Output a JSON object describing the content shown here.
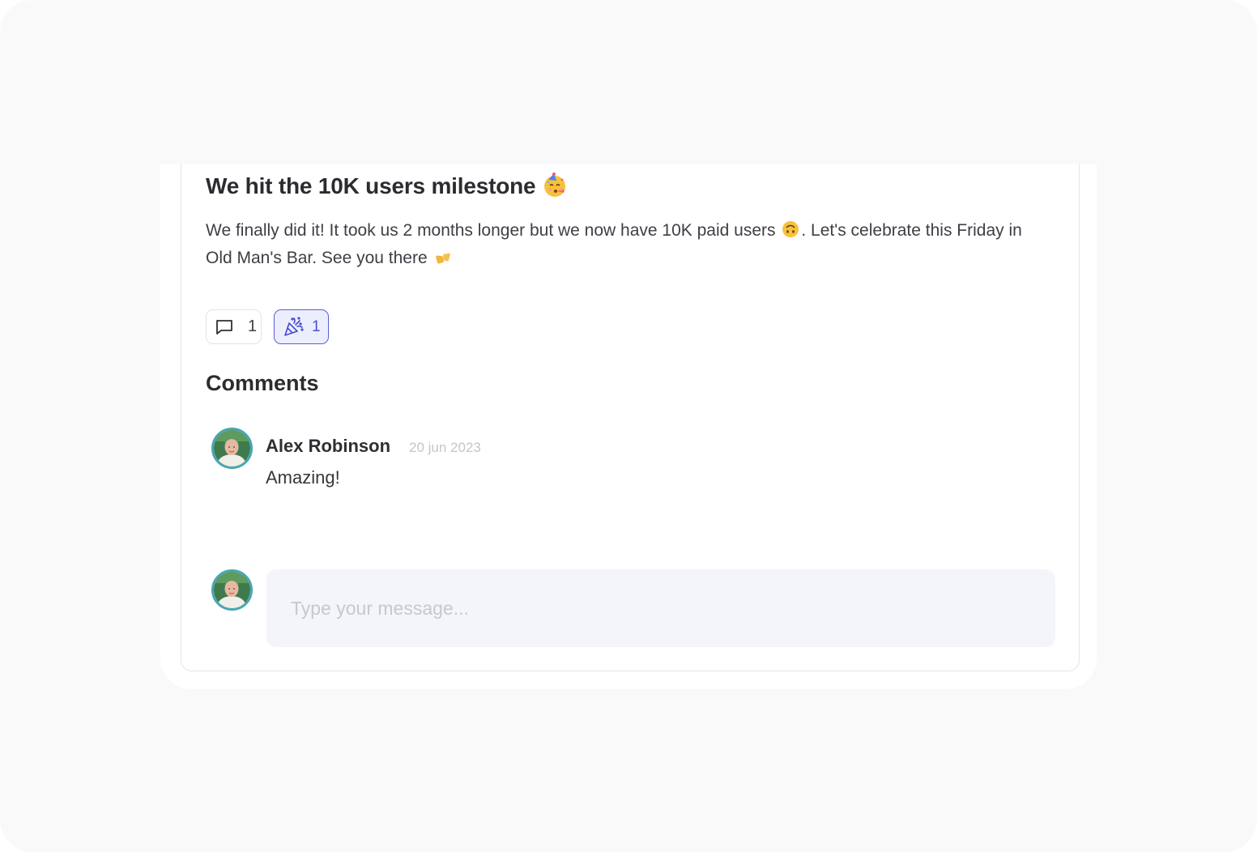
{
  "post": {
    "title": "We hit the 10K users milestone",
    "title_emoji": "partying-face-emoji",
    "body_part1": "We finally did it! It took us 2 months longer but we now have 10K paid users ",
    "body_emoji1": "upside-down-face-emoji",
    "body_part2": ". Let's celebrate this Friday in Old Man's Bar. See you there ",
    "body_emoji2": "beer-mugs-emoji"
  },
  "reactions": {
    "comments": {
      "icon": "comment-icon",
      "count": "1"
    },
    "party": {
      "icon": "party-popper-icon",
      "count": "1",
      "accent": "#4a4fd0",
      "background": "#eceefe"
    }
  },
  "comments_section": {
    "heading": "Comments",
    "items": [
      {
        "author": "Alex Robinson",
        "date": "20 jun 2023",
        "text": "Amazing!"
      }
    ]
  },
  "composer": {
    "placeholder": "Type your message..."
  }
}
